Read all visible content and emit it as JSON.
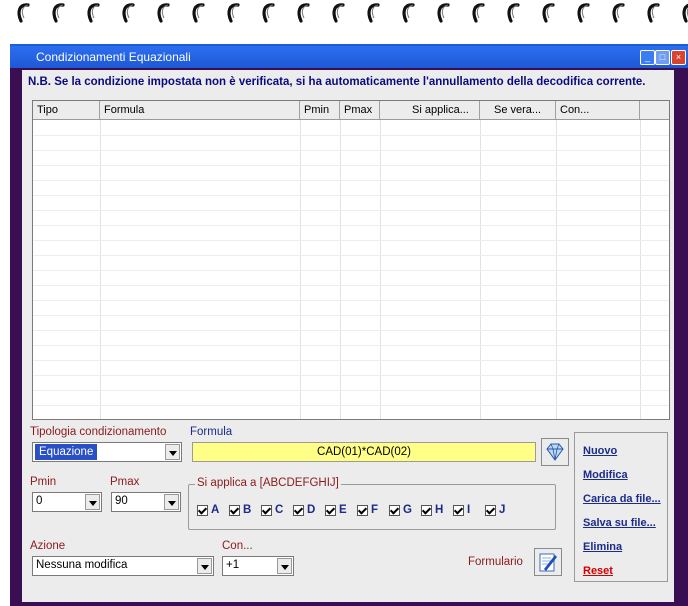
{
  "window": {
    "title": "Condizionamenti Equazionali"
  },
  "note": "N.B. Se la condizione impostata non è verificata, si ha automaticamente l'annullamento della decodifica corrente.",
  "table": {
    "columns": [
      "Tipo",
      "Formula",
      "Pmin",
      "Pmax",
      "Si applica...",
      "Se vera...",
      "Con..."
    ]
  },
  "tipologia": {
    "label": "Tipologia condizionamento",
    "value": "Equazione"
  },
  "formula": {
    "label": "Formula",
    "value": "CAD(01)*CAD(02)"
  },
  "pmin": {
    "label": "Pmin",
    "value": "0"
  },
  "pmax": {
    "label": "Pmax",
    "value": "90"
  },
  "si_applica": {
    "label": "Si applica a [ABCDEFGHIJ]",
    "letters": [
      "A",
      "B",
      "C",
      "D",
      "E",
      "F",
      "G",
      "H",
      "I",
      "J"
    ]
  },
  "azione": {
    "label": "Azione",
    "value": "Nessuna modifica"
  },
  "con": {
    "label": "Con...",
    "value": "+1"
  },
  "formulario": {
    "label": "Formulario"
  },
  "actions": {
    "nuovo": "Nuovo",
    "modifica": "Modifica",
    "carica": "Carica da file...",
    "salva": "Salva su file...",
    "elimina": "Elimina",
    "reset": "Reset"
  }
}
